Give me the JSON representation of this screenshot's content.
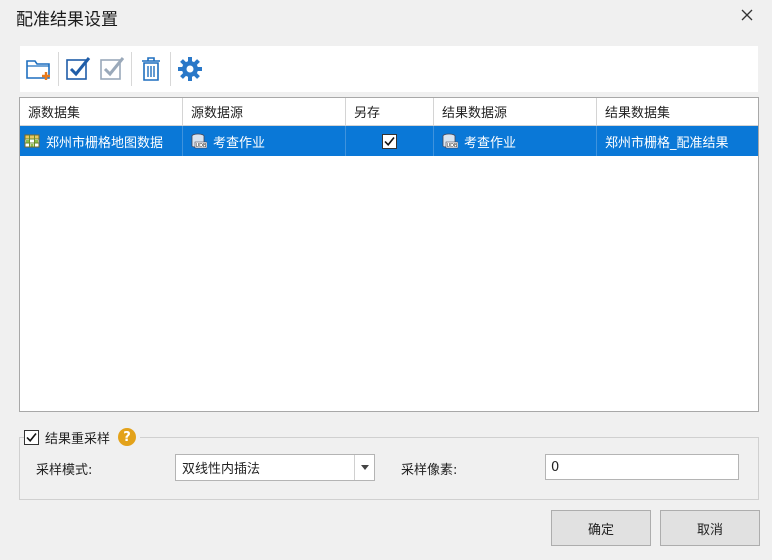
{
  "window": {
    "title": "配准结果设置",
    "close_icon": "close-icon"
  },
  "toolbar": {
    "icons": [
      "add-folder-icon",
      "check-all-icon",
      "uncheck-all-icon",
      "delete-icon",
      "settings-icon"
    ],
    "accent": "#1f6fbf"
  },
  "grid": {
    "columns": [
      "源数据集",
      "源数据源",
      "另存",
      "结果数据源",
      "结果数据集"
    ],
    "rows": [
      {
        "source_dataset": "郑州市栅格地图数据",
        "source_datasource": "考查作业",
        "save_as": true,
        "result_datasource": "考查作业",
        "result_dataset": "郑州市栅格_配准结果"
      }
    ],
    "selection_color": "#0a78d7"
  },
  "resample": {
    "checkbox_label": "结果重采样",
    "checked": true,
    "mode_label": "采样模式:",
    "mode_value": "双线性内插法",
    "pixel_label": "采样像素:",
    "pixel_value": "0",
    "help_color": "#e3a21a"
  },
  "buttons": {
    "ok": "确定",
    "cancel": "取消"
  }
}
